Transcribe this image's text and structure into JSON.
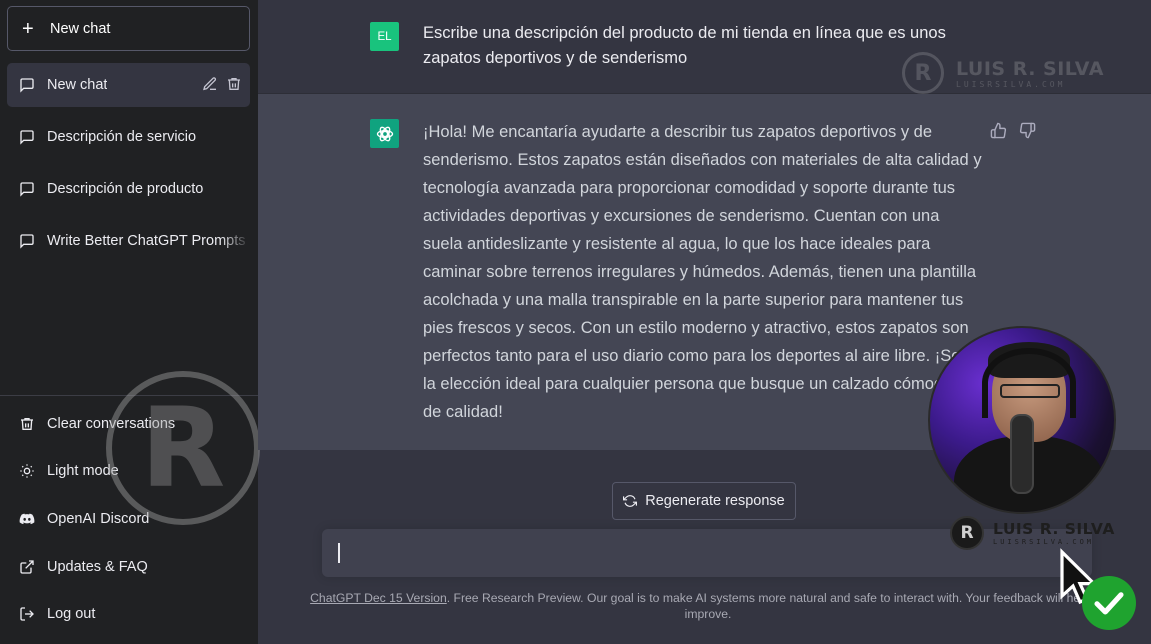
{
  "sidebar": {
    "new_chat_label": "New chat",
    "chats": [
      {
        "label": "New chat",
        "active": true
      },
      {
        "label": "Descripción de servicio",
        "active": false
      },
      {
        "label": "Descripción de producto",
        "active": false
      },
      {
        "label": "Write Better ChatGPT Prompts",
        "active": false
      }
    ],
    "bottom": [
      {
        "label": "Clear conversations",
        "icon": "trash-icon"
      },
      {
        "label": "Light mode",
        "icon": "sun-icon"
      },
      {
        "label": "OpenAI Discord",
        "icon": "discord-icon"
      },
      {
        "label": "Updates & FAQ",
        "icon": "external-link-icon"
      },
      {
        "label": "Log out",
        "icon": "logout-icon"
      }
    ]
  },
  "conversation": {
    "user_initials": "EL",
    "user_message": "Escribe una descripción del producto de mi tienda en línea que es unos zapatos deportivos y de senderismo",
    "assistant_message": "¡Hola! Me encantaría ayudarte a describir tus zapatos deportivos y de senderismo. Estos zapatos están diseñados con materiales de alta calidad y tecnología avanzada para proporcionar comodidad y soporte durante tus actividades deportivas y excursiones de senderismo. Cuentan con una suela antideslizante y resistente al agua, lo que los hace ideales para caminar sobre terrenos irregulares y húmedos. Además, tienen una plantilla acolchada y una malla transpirable en la parte superior para mantener tus pies frescos y secos. Con un estilo moderno y atractivo, estos zapatos son perfectos tanto para el uso diario como para los deportes al aire libre. ¡Son la elección ideal para cualquier persona que busque un calzado cómodo y de calidad!"
  },
  "composer": {
    "regenerate_label": "Regenerate response",
    "input_value": ""
  },
  "footer": {
    "link_text": "ChatGPT Dec 15 Version",
    "text": ". Free Research Preview. Our goal is to make AI systems more natural and safe to interact with. Your feedback will help us improve."
  },
  "watermark": {
    "logo_letter": "R",
    "brand_name": "LUIS R. SILVA",
    "brand_url": "LUISRSILVA.COM"
  },
  "colors": {
    "sidebar_bg": "#202123",
    "main_bg": "#343541",
    "assistant_bg": "#444654",
    "user_avatar": "#19c37d",
    "bot_avatar": "#10a37f",
    "check_badge": "#1fa32f"
  }
}
